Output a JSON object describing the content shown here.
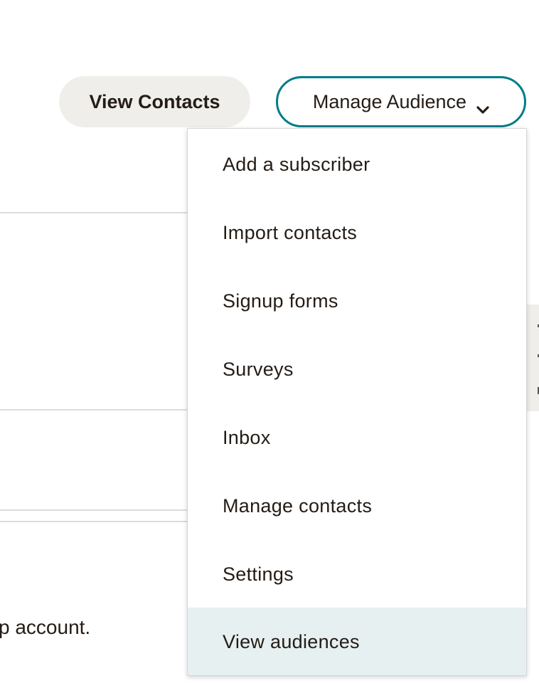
{
  "header": {
    "view_contacts_label": "View Contacts",
    "manage_audience_label": "Manage Audience"
  },
  "dropdown": {
    "items": [
      {
        "label": "Add a subscriber"
      },
      {
        "label": "Import contacts"
      },
      {
        "label": "Signup forms"
      },
      {
        "label": "Surveys"
      },
      {
        "label": "Inbox"
      },
      {
        "label": "Manage contacts"
      },
      {
        "label": "Settings"
      },
      {
        "label": "View audiences",
        "highlighted": true
      }
    ]
  },
  "background": {
    "partial_text": "p account."
  },
  "colors": {
    "accent": "#007c89",
    "button_bg": "#efeeea",
    "highlight": "#e6f0f0",
    "text": "#241c15"
  },
  "icons": {
    "manage_audience": "chevron-down-icon"
  }
}
